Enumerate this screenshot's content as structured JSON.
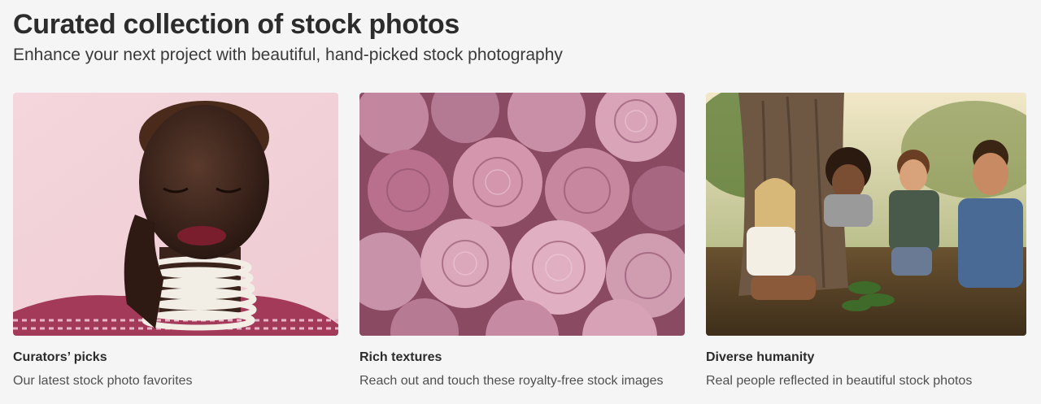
{
  "header": {
    "title": "Curated collection of stock photos",
    "subtitle": "Enhance your next project with beautiful, hand-picked stock photography"
  },
  "cards": [
    {
      "title": "Curators’ picks",
      "description": "Our latest stock photo favorites",
      "image_subject": "portrait of woman with beaded necklace on pink background"
    },
    {
      "title": "Rich textures",
      "description": "Reach out and touch these royalty-free stock images",
      "image_subject": "pink peony flowers close-up"
    },
    {
      "title": "Diverse humanity",
      "description": "Real people reflected in beautiful stock photos",
      "image_subject": "children playing outdoors by a tree"
    }
  ],
  "colors": {
    "background": "#f5f5f5",
    "text_primary": "#2c2c2c",
    "text_secondary": "#505050"
  }
}
